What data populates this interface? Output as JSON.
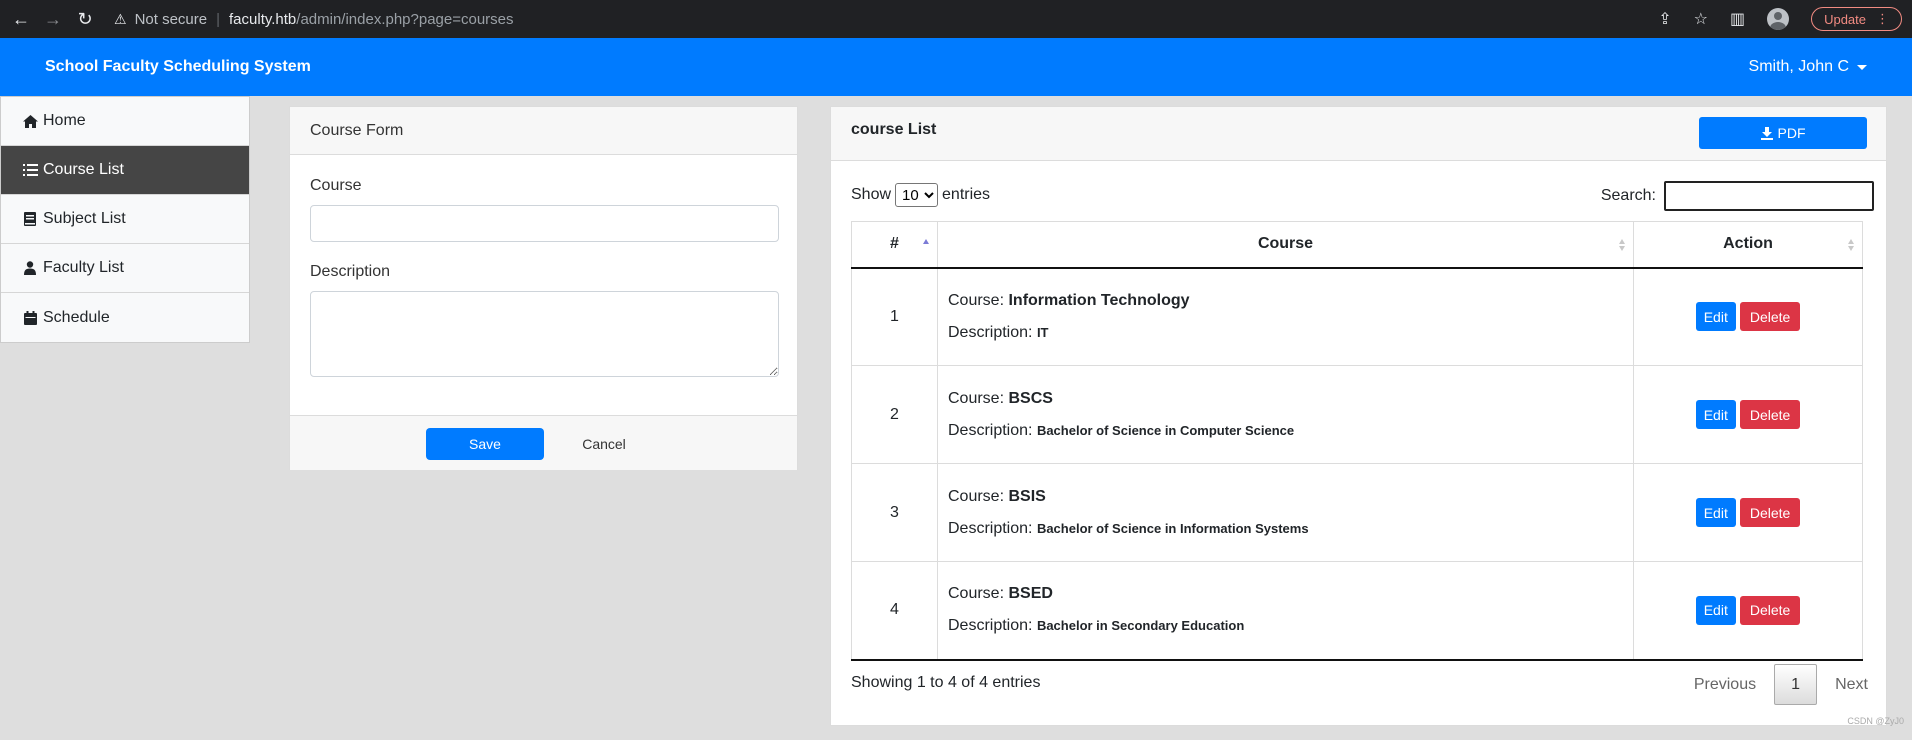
{
  "browser": {
    "security_label": "Not secure",
    "url_host": "faculty.htb",
    "url_path": "/admin/index.php?page=courses",
    "update_label": "Update"
  },
  "app": {
    "brand": "School Faculty Scheduling System",
    "user_name": "Smith, John C"
  },
  "sidebar": {
    "items": [
      {
        "label": "Home",
        "icon": "home-icon",
        "active": false
      },
      {
        "label": "Course List",
        "icon": "list-icon",
        "active": true
      },
      {
        "label": "Subject List",
        "icon": "book-icon",
        "active": false
      },
      {
        "label": "Faculty List",
        "icon": "user-tie-icon",
        "active": false
      },
      {
        "label": "Schedule",
        "icon": "calendar-icon",
        "active": false
      }
    ]
  },
  "form": {
    "title": "Course Form",
    "course_label": "Course",
    "course_value": "",
    "description_label": "Description",
    "description_value": "",
    "save_label": "Save",
    "cancel_label": "Cancel"
  },
  "list": {
    "title": "course List",
    "pdf_label": "PDF",
    "show_label": "Show",
    "entries_label": "entries",
    "page_length": "10",
    "search_label": "Search:",
    "search_value": "",
    "columns": [
      "#",
      "Course",
      "Action"
    ],
    "course_prefix": "Course:",
    "description_prefix": "Description:",
    "edit_label": "Edit",
    "delete_label": "Delete",
    "rows": [
      {
        "num": "1",
        "course": "Information Technology",
        "description": "IT"
      },
      {
        "num": "2",
        "course": "BSCS",
        "description": "Bachelor of Science in Computer Science"
      },
      {
        "num": "3",
        "course": "BSIS",
        "description": "Bachelor of Science in Information Systems"
      },
      {
        "num": "4",
        "course": "BSED",
        "description": "Bachelor in Secondary Education"
      }
    ],
    "info": "Showing 1 to 4 of 4 entries",
    "prev_label": "Previous",
    "current_page": "1",
    "next_label": "Next"
  },
  "watermark": "CSDN @ZyJ0"
}
